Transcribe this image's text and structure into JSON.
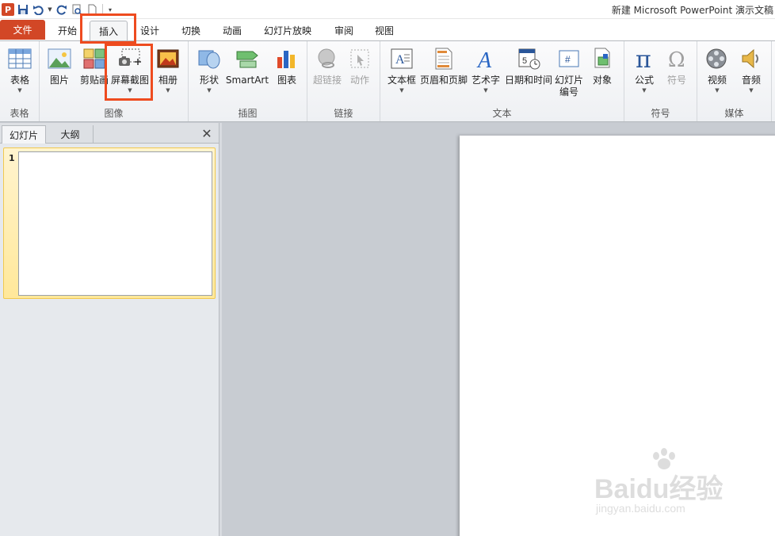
{
  "window": {
    "title": "新建 Microsoft PowerPoint 演示文稿"
  },
  "quick_access": {
    "logo_letter": "P"
  },
  "tabs": [
    "文件",
    "开始",
    "插入",
    "设计",
    "切换",
    "动画",
    "幻灯片放映",
    "审阅",
    "视图"
  ],
  "active_tab": "插入",
  "ribbon": {
    "groups": {
      "table": {
        "label": "表格",
        "buttons": [
          "表格"
        ]
      },
      "images": {
        "label": "图像",
        "buttons": [
          "图片",
          "剪贴画",
          "屏幕截图",
          "相册"
        ]
      },
      "illustrations": {
        "label": "插图",
        "buttons": [
          "形状",
          "SmartArt",
          "图表"
        ]
      },
      "links": {
        "label": "链接",
        "buttons": [
          "超链接",
          "动作"
        ]
      },
      "text": {
        "label": "文本",
        "buttons": [
          "文本框",
          "页眉和页脚",
          "艺术字",
          "日期和时间",
          "幻灯片编号",
          "对象"
        ]
      },
      "symbols": {
        "label": "符号",
        "buttons": [
          "公式",
          "符号"
        ]
      },
      "media": {
        "label": "媒体",
        "buttons": [
          "视频",
          "音频"
        ]
      }
    }
  },
  "slide_pane": {
    "tabs": [
      "幻灯片",
      "大纲"
    ],
    "active_tab": "幻灯片",
    "close_glyph": "✕"
  },
  "slides": [
    {
      "number": "1"
    }
  ],
  "watermark": {
    "brand": "Baidu经验",
    "url": "jingyan.baidu.com"
  },
  "colors": {
    "accent": "#d24726",
    "highlight": "#ee4b1f",
    "selection": "#ffe89a"
  }
}
